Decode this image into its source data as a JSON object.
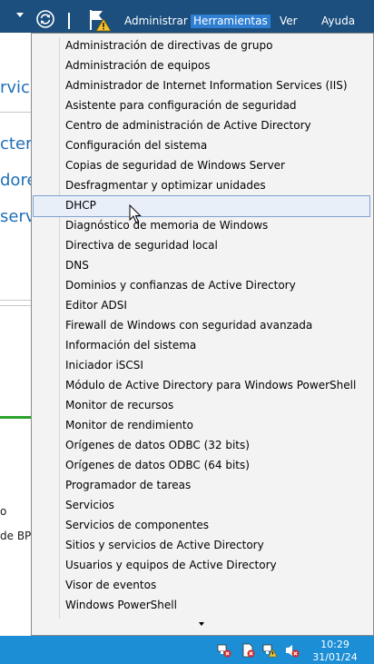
{
  "menubar": {
    "items": [
      "Administrar",
      "Herramientas",
      "Ver",
      "Ayuda"
    ],
    "active_item": "Herramientas",
    "colors": {
      "background": "#1c4f7e",
      "active": "#2e7fd2"
    }
  },
  "background": {
    "texts": [
      "rvic",
      "cterí",
      "dores",
      "servi",
      "o",
      "de BP"
    ]
  },
  "tools_menu": {
    "items": [
      "Administración de directivas de grupo",
      "Administración de equipos",
      "Administrador de Internet Information Services (IIS)",
      "Asistente para configuración de seguridad",
      "Centro de administración de Active Directory",
      "Configuración del sistema",
      "Copias de seguridad de Windows Server",
      "Desfragmentar y optimizar unidades",
      "DHCP",
      "Diagnóstico de memoria de Windows",
      "Directiva de seguridad local",
      "DNS",
      "Dominios y confianzas de Active Directory",
      "Editor ADSI",
      "Firewall de Windows con seguridad avanzada",
      "Información del sistema",
      "Iniciador iSCSI",
      "Módulo de Active Directory para Windows PowerShell",
      "Monitor de recursos",
      "Monitor de rendimiento",
      "Orígenes de datos ODBC (32 bits)",
      "Orígenes de datos ODBC (64 bits)",
      "Programador de tareas",
      "Servicios",
      "Servicios de componentes",
      "Sitios y servicios de Active Directory",
      "Usuarios y equipos de Active Directory",
      "Visor de eventos",
      "Windows PowerShell"
    ],
    "hovered_item": "DHCP"
  },
  "taskbar": {
    "time": "10:29",
    "date": "31/01/24",
    "color": "#1b8ed6",
    "tray_icons": [
      "network-error-icon",
      "file-error-icon",
      "network-warning-icon",
      "speaker-muted-icon"
    ]
  }
}
